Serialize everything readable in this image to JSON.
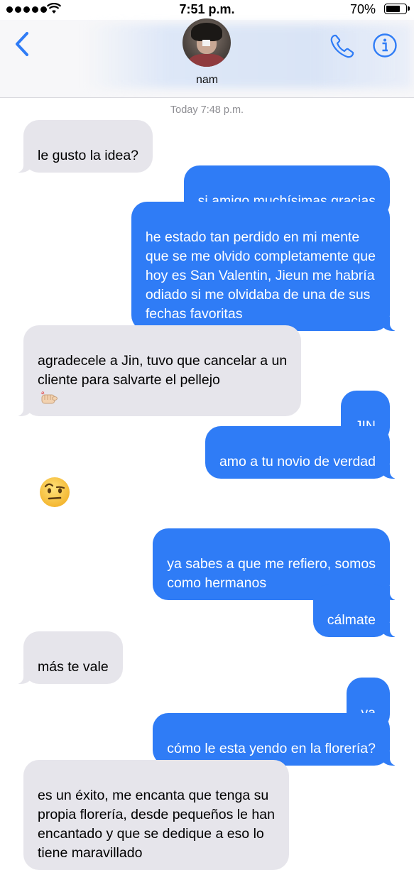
{
  "status_bar": {
    "time": "7:51 p.m.",
    "battery_percent": "70%",
    "battery_level": 0.7,
    "signal_bars": 5,
    "icons": [
      "signal-dots-icon",
      "wifi-icon",
      "battery-icon"
    ]
  },
  "header": {
    "contact_name": "nam",
    "icons": [
      "back-chevron-icon",
      "avatar",
      "phone-icon",
      "info-icon"
    ],
    "accent_color": "#2f7cf6"
  },
  "thread": {
    "timestamp": "Today 7:48 p.m.",
    "messages": [
      {
        "from": "them",
        "text": "le gusto la idea?"
      },
      {
        "from": "me",
        "text": "si amigo muchísimas gracias"
      },
      {
        "from": "me",
        "text": "he estado tan perdido en mi mente\nque se me olvido completamente que\nhoy es San Valentin, Jieun me habría\nodiado si me olvidaba de una de sus\nfechas favoritas"
      },
      {
        "from": "them",
        "text": "agradecele a Jin, tuvo que cancelar a un\ncliente para salvarte el pellejo",
        "emoji": "fist-icon"
      },
      {
        "from": "me",
        "text": "JIN"
      },
      {
        "from": "me",
        "text": "amo a tu novio de verdad"
      },
      {
        "from": "them",
        "emoji_only": "raised-eyebrow-emoji-icon"
      },
      {
        "from": "me",
        "text": "ya sabes a que me refiero, somos\ncomo hermanos"
      },
      {
        "from": "me",
        "text": "cálmate"
      },
      {
        "from": "them",
        "text": "más te vale"
      },
      {
        "from": "me",
        "text": "ya"
      },
      {
        "from": "me",
        "text": "cómo le esta yendo en la florería?"
      },
      {
        "from": "them",
        "text": "es un éxito, me encanta que tenga su\npropia florería, desde pequeños le han\nencantado y que se dedique a eso lo\ntiene maravillado"
      }
    ],
    "colors": {
      "incoming": "#e6e5eb",
      "outgoing": "#2f7cf6"
    }
  }
}
